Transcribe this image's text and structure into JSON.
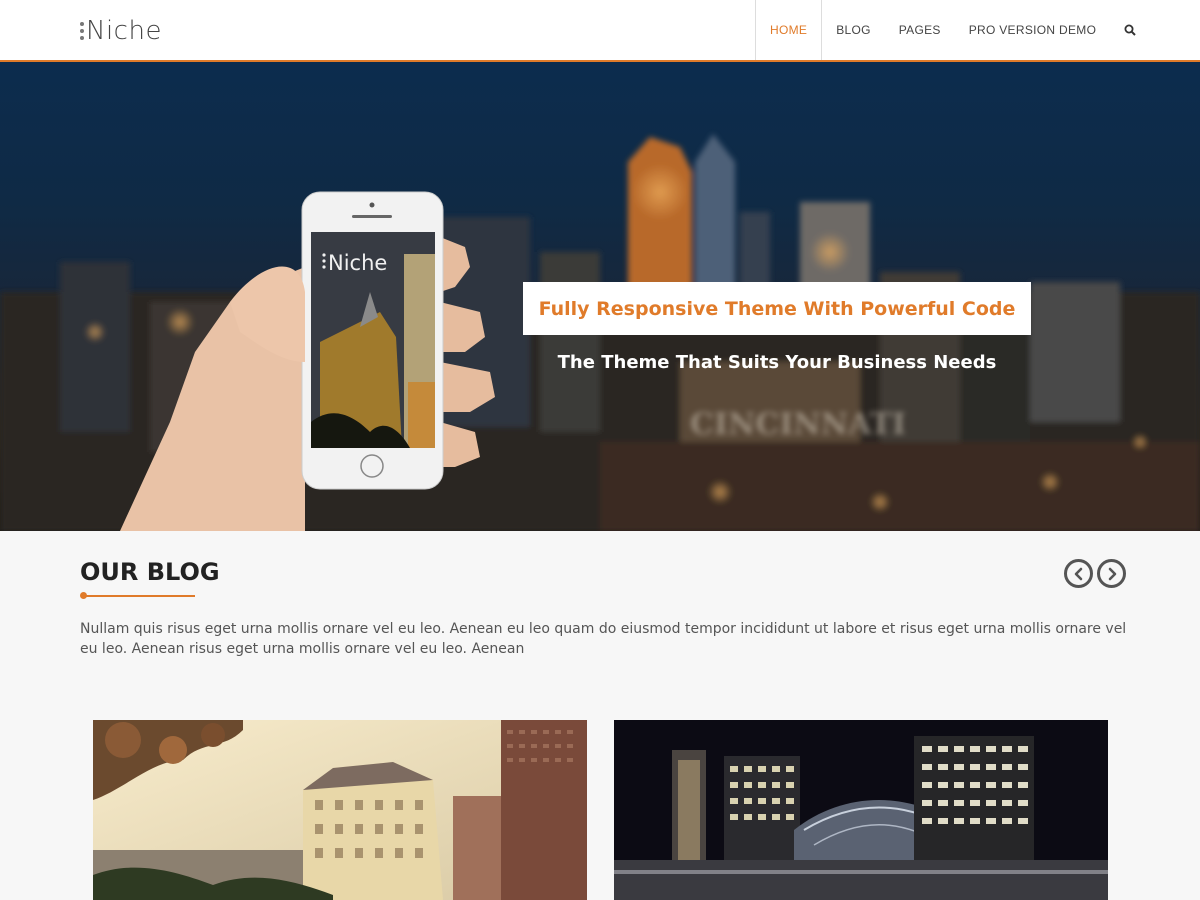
{
  "header": {
    "logo_text": "Niche",
    "nav": [
      {
        "label": "HOME",
        "active": true
      },
      {
        "label": "BLOG",
        "active": false
      },
      {
        "label": "PAGES",
        "active": false
      },
      {
        "label": "PRO VERSION DEMO",
        "active": false
      }
    ],
    "search_icon": "search-icon"
  },
  "hero": {
    "title": "Fully Responsive Theme With Powerful Code",
    "subtitle": "The Theme That Suits Your Business Needs",
    "phone_logo_text": "Niche",
    "city_sign_text": "CINCINNATI"
  },
  "blog": {
    "heading": "OUR BLOG",
    "description": "Nullam quis risus eget urna mollis ornare vel eu leo. Aenean eu leo quam do eiusmod tempor incididunt ut labore et risus eget urna mollis ornare vel eu leo. Aenean risus eget urna mollis ornare vel eu leo. Aenean",
    "prev_icon": "chevron-left-icon",
    "next_icon": "chevron-right-icon"
  },
  "colors": {
    "accent": "#e07b2a",
    "heading": "#222222",
    "body_text": "#555555",
    "header_bg": "#ffffff",
    "section_bg": "#f7f7f7"
  }
}
